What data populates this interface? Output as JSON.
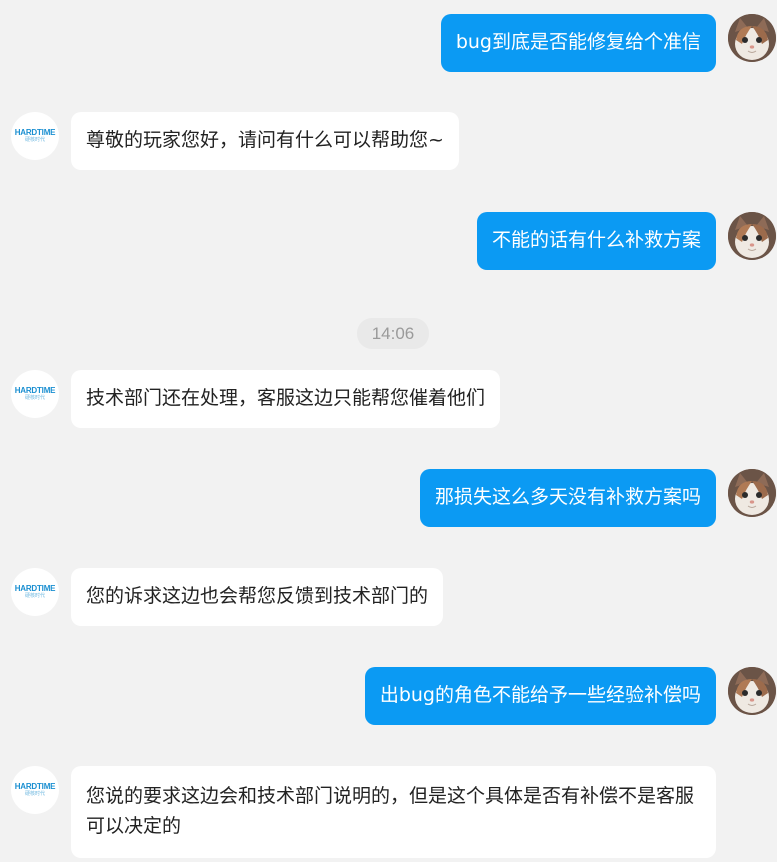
{
  "brand": {
    "logo_text": "HARDTIME",
    "logo_subtext": "硬核时代"
  },
  "timestamp": "14:06",
  "messages": [
    {
      "side": "out",
      "text": "bug到底是否能修复给个准信"
    },
    {
      "side": "in",
      "text": "尊敬的玩家您好，请问有什么可以帮助您~"
    },
    {
      "side": "out",
      "text": "不能的话有什么补救方案"
    },
    {
      "side": "in",
      "text": "技术部门还在处理，客服这边只能帮您催着他们"
    },
    {
      "side": "out",
      "text": "那损失这么多天没有补救方案吗"
    },
    {
      "side": "in",
      "text": "您的诉求这边也会帮您反馈到技术部门的"
    },
    {
      "side": "out",
      "text": "出bug的角色不能给予一些经验补偿吗"
    },
    {
      "side": "in",
      "text": "您说的要求这边会和技术部门说明的，但是这个具体是否有补偿不是客服可以决定的"
    }
  ],
  "colors": {
    "background": "#f2f2f2",
    "outgoing_bubble": "#0b9af3",
    "incoming_bubble": "#ffffff",
    "timestamp_text": "#9a9a9a"
  }
}
